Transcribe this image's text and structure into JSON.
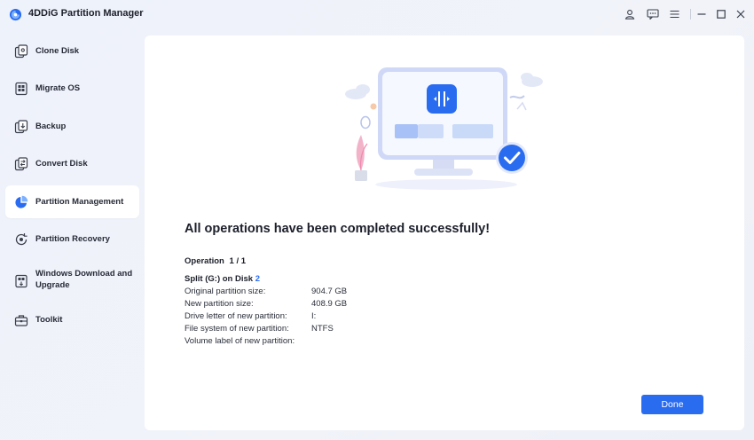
{
  "app": {
    "title": "4DDiG Partition Manager"
  },
  "titlebar": {
    "icons": [
      "user-icon",
      "feedback-icon",
      "menu-icon",
      "minimize-icon",
      "maximize-icon",
      "close-icon"
    ]
  },
  "sidebar": {
    "items": [
      {
        "label": "Clone Disk",
        "icon": "clone-disk-icon"
      },
      {
        "label": "Migrate OS",
        "icon": "migrate-os-icon"
      },
      {
        "label": "Backup",
        "icon": "backup-icon"
      },
      {
        "label": "Convert Disk",
        "icon": "convert-disk-icon"
      },
      {
        "label": "Partition Management",
        "icon": "partition-management-icon",
        "active": true
      },
      {
        "label": "Partition Recovery",
        "icon": "partition-recovery-icon"
      },
      {
        "label": "Windows Download and Upgrade",
        "label_line1": "Windows Download and",
        "label_line2": "Upgrade",
        "icon": "windows-download-icon"
      },
      {
        "label": "Toolkit",
        "icon": "toolkit-icon"
      }
    ]
  },
  "main": {
    "headline": "All operations have been completed successfully!",
    "operation_label": "Operation",
    "operation_count": "1 / 1",
    "split_text": "Split (G:) on Disk",
    "disk_number": "2",
    "details": [
      {
        "label": "Original partition size:",
        "value": "904.7 GB"
      },
      {
        "label": "New partition size:",
        "value": "408.9 GB"
      },
      {
        "label": "Drive letter of new partition:",
        "value": "I:"
      },
      {
        "label": "File system of new partition:",
        "value": "NTFS"
      },
      {
        "label": "Volume label of new partition:",
        "value": ""
      }
    ],
    "done_label": "Done"
  },
  "colors": {
    "accent": "#2a6cf0",
    "success": "#2a6cf0",
    "active_bg": "#ffffff"
  }
}
